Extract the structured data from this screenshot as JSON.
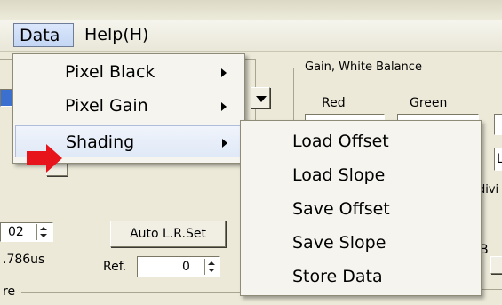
{
  "menubar": {
    "items": [
      {
        "label": "Data"
      },
      {
        "label": "Help(H)"
      }
    ]
  },
  "data_menu": {
    "items": [
      {
        "label": "Pixel Black"
      },
      {
        "label": "Pixel Gain"
      },
      {
        "label": "Shading"
      }
    ]
  },
  "shading_submenu": {
    "items": [
      {
        "label": "Load Offset"
      },
      {
        "label": "Load Slope"
      },
      {
        "label": "Save Offset"
      },
      {
        "label": "Save Slope"
      },
      {
        "label": "Store Data"
      }
    ]
  },
  "background": {
    "gain_group_title": "Gain, White Balance",
    "red_label": "Red",
    "green_label": "Green",
    "spin_value_1": "02",
    "time_value": ".786us",
    "auto_lr_button": "Auto L.R.Set",
    "ref_label": "Ref.",
    "ref_value": "0",
    "partial_label_re": "re",
    "partial_label_divi": "divi",
    "partial_label_l": "L",
    "partial_label_b": "B"
  },
  "colors": {
    "accent_selected": "#c4d6f4",
    "pointer_arrow": "#e8141c",
    "window_background": "#ece9d8"
  }
}
